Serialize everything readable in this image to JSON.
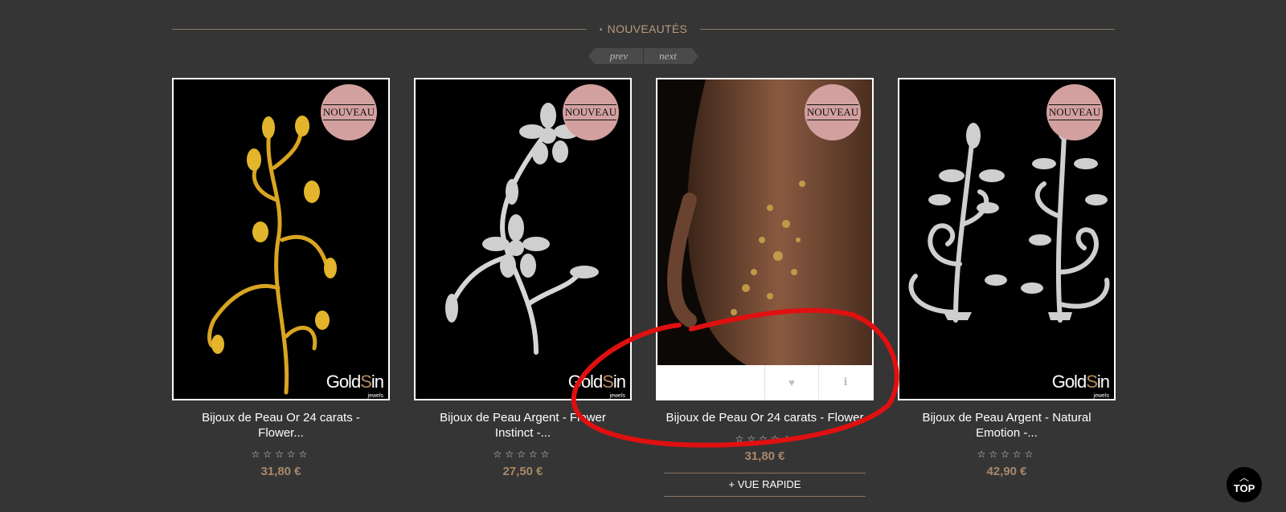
{
  "section": {
    "title": "NOUVEAUTÉS",
    "bullet": "•"
  },
  "pager": {
    "prev": "prev",
    "next": "next"
  },
  "badge_text": "NOUVEAU",
  "logo": {
    "main_a": "Gold",
    "main_s": "S",
    "main_b": "in",
    "sub": "jewels"
  },
  "products": [
    {
      "name": "Bijoux de Peau Or 24 carats - Flower...",
      "stars": "☆☆☆☆☆",
      "price": "31,80 €"
    },
    {
      "name": "Bijoux de Peau Argent - Flower Instinct -...",
      "stars": "☆☆☆☆☆",
      "price": "27,50 €"
    },
    {
      "name": "Bijoux de Peau Or 24 carats - Flower",
      "stars": "☆☆☆☆☆",
      "price": "31,80 €",
      "quick_view": "VUE RAPIDE",
      "quick_view_icon": "+"
    },
    {
      "name": "Bijoux de Peau Argent - Natural Emotion -...",
      "stars": "☆☆☆☆☆",
      "price": "42,90 €"
    }
  ],
  "icons": {
    "wishlist": "heart-icon",
    "info": "info-icon"
  },
  "top_button": {
    "label": "TOP",
    "chevron": "︿"
  },
  "colors": {
    "accent": "#b89a7c",
    "price": "#a9876a",
    "badge": "#d3a0a0",
    "annotation": "#e01010"
  }
}
